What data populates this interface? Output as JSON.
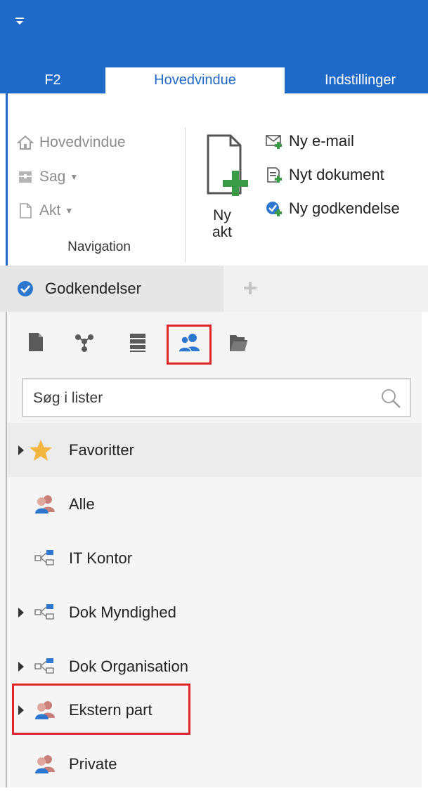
{
  "quick_access": {
    "icon": "quick-access-dropdown-icon"
  },
  "tabs": [
    {
      "label": "F2"
    },
    {
      "label": "Hovedvindue"
    },
    {
      "label": "Indstillinger"
    }
  ],
  "ribbon": {
    "navigation": {
      "items": [
        {
          "label": "Hovedvindue",
          "icon": "home-icon"
        },
        {
          "label": "Sag",
          "icon": "case-icon"
        },
        {
          "label": "Akt",
          "icon": "document-icon"
        }
      ],
      "group_label": "Navigation"
    },
    "new_act": {
      "line1": "Ny",
      "line2": "akt",
      "icon": "new-document-icon"
    },
    "actions": [
      {
        "label": "Ny e-mail",
        "icon": "new-email-icon"
      },
      {
        "label": "Nyt dokument",
        "icon": "new-text-document-icon"
      },
      {
        "label": "Ny godkendelse",
        "icon": "new-approval-icon"
      }
    ]
  },
  "doc_tab": {
    "label": "Godkendelser",
    "icon": "approval-check-icon"
  },
  "pane": {
    "icon_bar": [
      "document-icon",
      "org-chart-icon",
      "list-icon",
      "users-icon",
      "folder-open-icon"
    ],
    "active_icon": "users-icon",
    "search_placeholder": "Søg i lister",
    "items": [
      {
        "label": "Favoritter",
        "icon": "star-icon",
        "expandable": true
      },
      {
        "label": "Alle",
        "icon": "people-icon",
        "expandable": false
      },
      {
        "label": "IT Kontor",
        "icon": "org-unit-icon",
        "expandable": false
      },
      {
        "label": "Dok Myndighed",
        "icon": "org-unit-icon",
        "expandable": true
      },
      {
        "label": "Dok Organisation",
        "icon": "org-unit-icon",
        "expandable": true
      },
      {
        "label": "Ekstern part",
        "icon": "people-icon",
        "expandable": true
      },
      {
        "label": "Private",
        "icon": "people-icon",
        "expandable": false
      }
    ]
  },
  "colors": {
    "accent": "#1f69c8",
    "highlight": "#e0222a",
    "green": "#3a9a45"
  }
}
